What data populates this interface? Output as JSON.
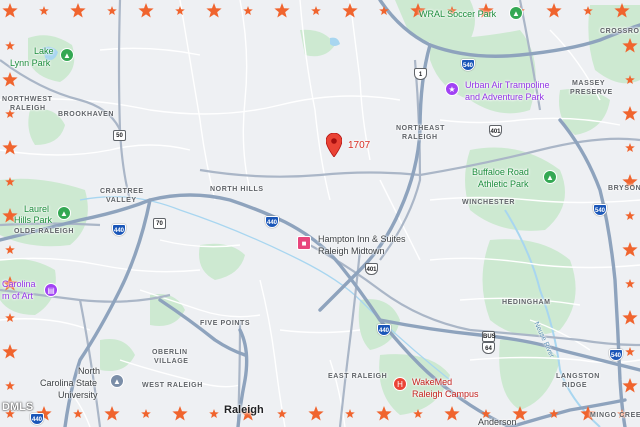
{
  "map": {
    "pin_label": "1707",
    "watermark": "DMLS",
    "labels": {
      "wral_soccer_park": "WRAL Soccer Park",
      "crossroads": "CROSSRO",
      "lake_lynn_park_1": "Lake",
      "lake_lynn_park_2": "Lynn Park",
      "northwest_raleigh_1": "NORTHWEST",
      "northwest_raleigh_2": "RALEIGH",
      "brookhaven": "BROOKHAVEN",
      "urban_air_1": "Urban Air Trampoline",
      "urban_air_2": "and Adventure Park",
      "massey_preserve_1": "MASSEY",
      "massey_preserve_2": "PRESERVE",
      "northeast_raleigh_1": "NORTHEAST",
      "northeast_raleigh_2": "RALEIGH",
      "buffaloe_road_1": "Buffaloe Road",
      "buffaloe_road_2": "Athletic Park",
      "bryson": "BRYSON",
      "crabtree_valley_1": "CRABTREE",
      "crabtree_valley_2": "VALLEY",
      "north_hills": "NORTH HILLS",
      "winchester": "WINCHESTER",
      "laurel_hills_park_1": "Laurel",
      "laurel_hills_park_2": "Hills Park",
      "olde_raleigh": "OLDE RALEIGH",
      "hampton_inn_1": "Hampton Inn & Suites",
      "hampton_inn_2": "Raleigh Midtown",
      "museum_art_1": "Carolina",
      "museum_art_2": "m of Art",
      "hedingham": "HEDINGHAM",
      "five_points": "FIVE POINTS",
      "oberlin_1": "OBERLIN",
      "oberlin_2": "VILLAGE",
      "langston_ridge_1": "LANGSTON",
      "langston_ridge_2": "RIDGE",
      "nc_state_1": "North",
      "nc_state_2": "Carolina State",
      "nc_state_3": "University",
      "west_raleigh": "WEST RALEIGH",
      "east_raleigh": "EAST RALEIGH",
      "wakemed_1": "WakeMed",
      "wakemed_2": "Raleigh Campus",
      "raleigh": "Raleigh",
      "anderson": "Anderson",
      "mingo_creek": "MINGO CREEK",
      "neuse_river": "Neuse River"
    },
    "shields": {
      "i540_north": "540",
      "us1": "1",
      "i440_northwest": "440",
      "nc50": "50",
      "nc70": "70",
      "i440_center": "440",
      "nc401_north": "401",
      "nc401_south": "401",
      "i440_southeast": "440",
      "i540_east": "540",
      "us64_east": "64",
      "bus64": "BUS",
      "i540_south": "540",
      "i440_south": "440"
    },
    "icons": {
      "pin": "map-pin-icon",
      "park": "park-tree-icon",
      "amusement": "amusement-park-icon",
      "museum": "museum-icon",
      "school": "school-icon",
      "hospital": "hospital-icon",
      "hotel": "hotel-icon"
    },
    "colors": {
      "land": "#eef0f3",
      "park": "#cde9d1",
      "water": "#a8d6f0",
      "highway": "#9fb1c9",
      "road": "#ffffff",
      "pin": "#ea4335",
      "border_star": "#f0642e"
    }
  }
}
